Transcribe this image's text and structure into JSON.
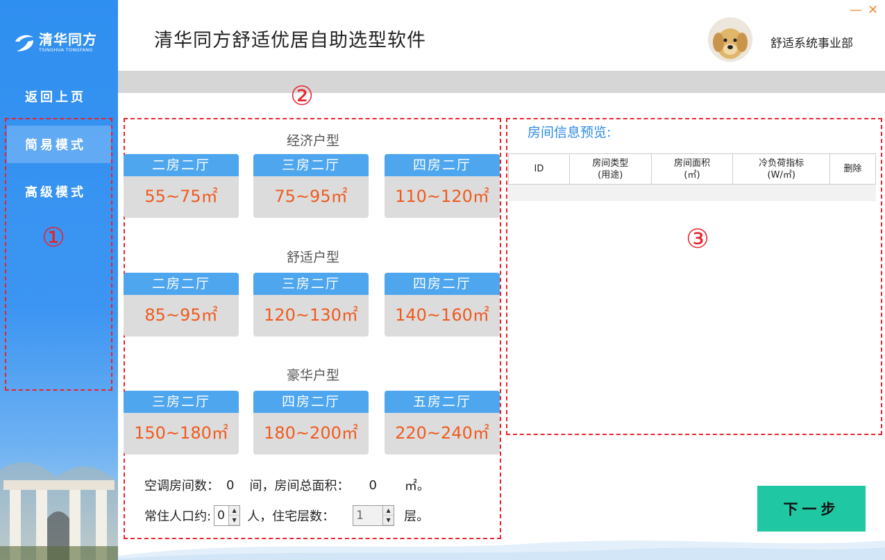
{
  "app": {
    "logo_cn": "清华同方",
    "logo_en": "TSINGHUA TONGFANG",
    "title": "清华同方舒适优居自助选型软件",
    "department": "舒适系统事业部",
    "minimize": "—",
    "close": "✕"
  },
  "sidebar": {
    "back": "返回上页",
    "simple": "简易模式",
    "advanced": "高级模式"
  },
  "callouts": {
    "one": "①",
    "two": "②",
    "three": "③"
  },
  "sections": {
    "economy": {
      "title": "经济户型",
      "cards": [
        {
          "name": "二房二厅",
          "area": "55~75㎡"
        },
        {
          "name": "三房二厅",
          "area": "75~95㎡"
        },
        {
          "name": "四房二厅",
          "area": "110~120㎡"
        }
      ]
    },
    "comfort": {
      "title": "舒适户型",
      "cards": [
        {
          "name": "二房二厅",
          "area": "85~95㎡"
        },
        {
          "name": "三房二厅",
          "area": "120~130㎡"
        },
        {
          "name": "四房二厅",
          "area": "140~160㎡"
        }
      ]
    },
    "luxury": {
      "title": "豪华户型",
      "cards": [
        {
          "name": "三房二厅",
          "area": "150~180㎡"
        },
        {
          "name": "四房二厅",
          "area": "180~200㎡"
        },
        {
          "name": "五房二厅",
          "area": "220~240㎡"
        }
      ]
    }
  },
  "form": {
    "room_count_label": "空调房间数：",
    "room_count": "0",
    "room_unit": "间，房间总面积：",
    "total_area": "0",
    "area_unit": "㎡。",
    "residents_label": "常住人口约:",
    "residents": "0",
    "residents_unit": "人，住宅层数：",
    "floors": "1",
    "floors_unit": "层。",
    "spin_up": "▲",
    "spin_down": "▼"
  },
  "preview": {
    "title": "房间信息预览:",
    "columns": [
      {
        "line1": "ID",
        "line2": ""
      },
      {
        "line1": "房间类型",
        "line2": "(用途)"
      },
      {
        "line1": "房间面积",
        "line2": "(㎡)"
      },
      {
        "line1": "冷负荷指标",
        "line2": "(W/㎡)"
      },
      {
        "line1": "删除",
        "line2": ""
      }
    ]
  },
  "next_button": "下一步",
  "colors": {
    "sidebar_blue": "#2f8ff0",
    "card_header_blue": "#4ea6ef",
    "area_orange": "#f05a1e",
    "callout_red": "#e8242d",
    "next_green": "#1fc7a2",
    "preview_title_blue": "#2b8ae8"
  }
}
